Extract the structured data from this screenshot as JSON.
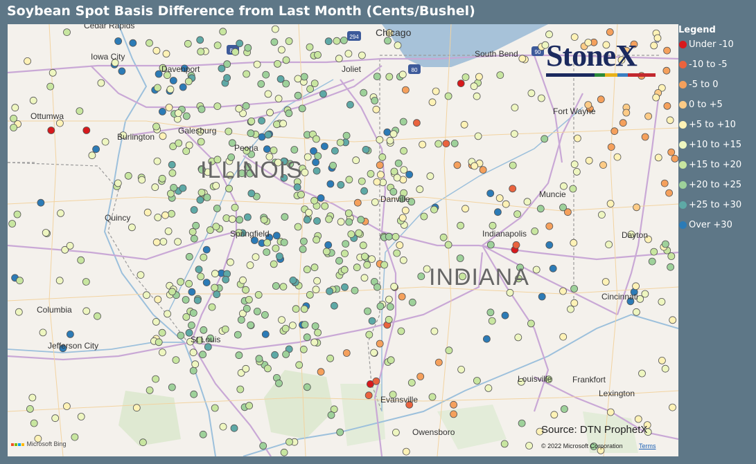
{
  "title": "Soybean Spot Basis Difference from Last Month (Cents/Bushel)",
  "legend": {
    "title": "Legend",
    "items": [
      {
        "label": "Under -10",
        "color": "#d7191c"
      },
      {
        "label": "-10 to -5",
        "color": "#ea633e"
      },
      {
        "label": "-5 to 0",
        "color": "#f5a05c"
      },
      {
        "label": "0 to +5",
        "color": "#fdcb86"
      },
      {
        "label": "+5 to +10",
        "color": "#fef2b6"
      },
      {
        "label": "+10 to +15",
        "color": "#eef6c0"
      },
      {
        "label": "+15 to +20",
        "color": "#c8e6a0"
      },
      {
        "label": "+20 to +25",
        "color": "#9ed19a"
      },
      {
        "label": "+25 to +30",
        "color": "#5ea9a6"
      },
      {
        "label": "Over +30",
        "color": "#2c7bb6"
      }
    ]
  },
  "map": {
    "states": [
      "ILLINOIS",
      "INDIANA"
    ],
    "cities": [
      "Cedar Rapids",
      "Iowa City",
      "Davenport",
      "Ottumwa",
      "Burlington",
      "Galesburg",
      "Peoria",
      "Quincy",
      "Springfield",
      "Columbia",
      "Jefferson City",
      "St Louis",
      "Chicago",
      "Joliet",
      "South Bend",
      "Fort Wayne",
      "Danville",
      "Muncie",
      "Indianapolis",
      "Dayton",
      "Cincinnati",
      "Louisville",
      "Frankfort",
      "Lexington",
      "Evansville",
      "Owensboro"
    ],
    "highways": [
      "294",
      "88",
      "90",
      "80"
    ]
  },
  "brand": {
    "logo_text": "StoneX",
    "tm": "™"
  },
  "source": "Source: DTN ProphetX",
  "copyright": "© 2022 Microsoft Corporation",
  "terms": "Terms",
  "bing": "Microsoft Bing",
  "points": [
    {
      "lon": -91.5,
      "lat": 41.97,
      "level": 9
    },
    {
      "lon": -91.3,
      "lat": 41.95,
      "level": 9
    },
    {
      "lon": -91.55,
      "lat": 41.72,
      "level": 9
    },
    {
      "lon": -91.45,
      "lat": 41.65,
      "level": 9
    },
    {
      "lon": -90.95,
      "lat": 41.62,
      "level": 9
    },
    {
      "lon": -90.75,
      "lat": 41.55,
      "level": 9
    },
    {
      "lon": -90.8,
      "lat": 41.44,
      "level": 9
    },
    {
      "lon": -91.0,
      "lat": 41.45,
      "level": 9
    },
    {
      "lon": -90.9,
      "lat": 41.22,
      "level": 9
    },
    {
      "lon": -90.6,
      "lat": 41.68,
      "level": 9
    },
    {
      "lon": -90.62,
      "lat": 41.48,
      "level": 9
    },
    {
      "lon": -92.41,
      "lat": 41.02,
      "level": 0
    },
    {
      "lon": -91.93,
      "lat": 41.02,
      "level": 0
    },
    {
      "lon": -91.8,
      "lat": 40.82,
      "level": 9
    },
    {
      "lon": -92.55,
      "lat": 40.25,
      "level": 9
    },
    {
      "lon": -92.9,
      "lat": 39.45,
      "level": 9
    },
    {
      "lon": -92.15,
      "lat": 38.85,
      "level": 9
    },
    {
      "lon": -92.25,
      "lat": 38.7,
      "level": 9
    },
    {
      "lon": -89.55,
      "lat": 40.95,
      "level": 9
    },
    {
      "lon": -89.45,
      "lat": 40.98,
      "level": 9
    },
    {
      "lon": -89.48,
      "lat": 40.82,
      "level": 9
    },
    {
      "lon": -88.7,
      "lat": 40.85,
      "level": 9
    },
    {
      "lon": -88.85,
      "lat": 40.8,
      "level": 9
    },
    {
      "lon": -88.82,
      "lat": 40.68,
      "level": 9
    },
    {
      "lon": -88.6,
      "lat": 40.62,
      "level": 9
    },
    {
      "lon": -88.62,
      "lat": 40.45,
      "level": 9
    },
    {
      "lon": -88.75,
      "lat": 40.3,
      "level": 9
    },
    {
      "lon": -89.35,
      "lat": 39.9,
      "level": 9
    },
    {
      "lon": -89.45,
      "lat": 39.88,
      "level": 9
    },
    {
      "lon": -89.65,
      "lat": 39.85,
      "level": 9
    },
    {
      "lon": -89.55,
      "lat": 39.82,
      "level": 9
    },
    {
      "lon": -89.3,
      "lat": 39.65,
      "level": 9
    },
    {
      "lon": -89.1,
      "lat": 39.4,
      "level": 9
    },
    {
      "lon": -90.1,
      "lat": 39.5,
      "level": 9
    },
    {
      "lon": -90.3,
      "lat": 39.4,
      "level": 9
    },
    {
      "lon": -90.5,
      "lat": 39.3,
      "level": 9
    },
    {
      "lon": -90.3,
      "lat": 39.75,
      "level": 9
    },
    {
      "lon": -88.65,
      "lat": 39.8,
      "level": 9
    },
    {
      "lon": -88.95,
      "lat": 39.15,
      "level": 9
    },
    {
      "lon": -89.5,
      "lat": 38.85,
      "level": 9
    },
    {
      "lon": -89.0,
      "lat": 38.95,
      "level": 9
    },
    {
      "lon": -87.85,
      "lat": 41.0,
      "level": 9
    },
    {
      "lon": -87.55,
      "lat": 40.55,
      "level": 9
    },
    {
      "lon": -87.2,
      "lat": 40.2,
      "level": 9
    },
    {
      "lon": -86.45,
      "lat": 40.35,
      "level": 9
    },
    {
      "lon": -86.35,
      "lat": 40.15,
      "level": 9
    },
    {
      "lon": -85.65,
      "lat": 39.8,
      "level": 9
    },
    {
      "lon": -85.6,
      "lat": 39.55,
      "level": 9
    },
    {
      "lon": -85.75,
      "lat": 39.25,
      "level": 9
    },
    {
      "lon": -84.5,
      "lat": 39.3,
      "level": 9
    },
    {
      "lon": -84.55,
      "lat": 39.2,
      "level": 9
    },
    {
      "lon": -86.25,
      "lat": 39.05,
      "level": 9
    },
    {
      "lon": -86.5,
      "lat": 38.8,
      "level": 9
    },
    {
      "lon": -86.12,
      "lat": 39.75,
      "level": 0
    },
    {
      "lon": -86.85,
      "lat": 41.52,
      "level": 0
    },
    {
      "lon": -88.08,
      "lat": 38.32,
      "level": 0
    },
    {
      "lon": -88.1,
      "lat": 38.2,
      "level": 1
    },
    {
      "lon": -88.0,
      "lat": 38.35,
      "level": 1
    },
    {
      "lon": -87.85,
      "lat": 38.95,
      "level": 1
    },
    {
      "lon": -87.55,
      "lat": 38.1,
      "level": 1
    },
    {
      "lon": -86.15,
      "lat": 40.4,
      "level": 1
    },
    {
      "lon": -86.1,
      "lat": 39.8,
      "level": 1
    },
    {
      "lon": -87.45,
      "lat": 41.1,
      "level": 1
    },
    {
      "lon": -87.05,
      "lat": 40.88,
      "level": 1
    },
    {
      "lon": -88.25,
      "lat": 40.25,
      "level": 2
    },
    {
      "lon": -88.15,
      "lat": 40.05,
      "level": 2
    },
    {
      "lon": -87.95,
      "lat": 39.6,
      "level": 2
    },
    {
      "lon": -87.65,
      "lat": 39.25,
      "level": 2
    },
    {
      "lon": -87.75,
      "lat": 39.35,
      "level": 2
    },
    {
      "lon": -87.95,
      "lat": 38.75,
      "level": 2
    },
    {
      "lon": -87.4,
      "lat": 38.4,
      "level": 2
    },
    {
      "lon": -87.15,
      "lat": 38.55,
      "level": 2
    },
    {
      "lon": -86.55,
      "lat": 40.6,
      "level": 2
    },
    {
      "lon": -85.65,
      "lat": 40.0,
      "level": 2
    },
    {
      "lon": -85.4,
      "lat": 40.15,
      "level": 2
    },
    {
      "lon": -84.95,
      "lat": 41.35,
      "level": 2
    },
    {
      "lon": -85.1,
      "lat": 41.25,
      "level": 2
    },
    {
      "lon": -84.65,
      "lat": 41.1,
      "level": 2
    },
    {
      "lon": -84.4,
      "lat": 41.6,
      "level": 2
    },
    {
      "lon": -84.35,
      "lat": 40.95,
      "level": 2
    },
    {
      "lon": -86.9,
      "lat": 40.65,
      "level": 2
    },
    {
      "lon": -86.7,
      "lat": 40.65,
      "level": 2
    },
    {
      "lon": -87.6,
      "lat": 41.45,
      "level": 2
    },
    {
      "lon": -87.95,
      "lat": 40.65,
      "level": 2
    },
    {
      "lon": -86.95,
      "lat": 38.1,
      "level": 2
    },
    {
      "lon": -86.95,
      "lat": 38.0,
      "level": 2
    },
    {
      "lon": -88.4,
      "lat": 38.65,
      "level": 2
    },
    {
      "lon": -88.75,
      "lat": 38.45,
      "level": 2
    }
  ]
}
